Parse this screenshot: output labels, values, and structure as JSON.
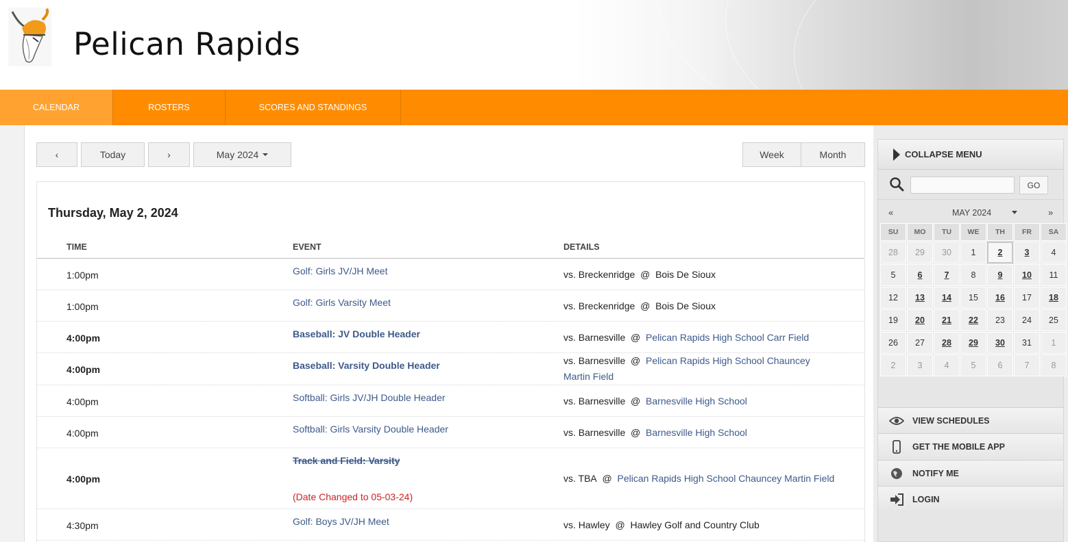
{
  "site": {
    "title": "Pelican Rapids"
  },
  "nav": [
    {
      "label": "CALENDAR"
    },
    {
      "label": "ROSTERS"
    },
    {
      "label": "SCORES AND STANDINGS"
    }
  ],
  "toolbar": {
    "prev": "‹",
    "today": "Today",
    "next": "›",
    "month_select": "May 2024",
    "week": "Week",
    "month": "Month"
  },
  "day": {
    "title": "Thursday, May 2, 2024",
    "columns": {
      "time": "TIME",
      "event": "EVENT",
      "details": "DETAILS"
    },
    "events": [
      {
        "time": "1:00pm",
        "event": "Golf: Girls JV/JH Meet",
        "opponent": "vs. Breckenridge",
        "at": "@",
        "location": "Bois De Sioux"
      },
      {
        "time": "1:00pm",
        "event": "Golf: Girls Varsity Meet",
        "opponent": "vs. Breckenridge",
        "at": "@",
        "location": "Bois De Sioux"
      },
      {
        "time": "4:00pm",
        "event": "Baseball: JV Double Header",
        "opponent": "vs. Barnesville",
        "at": "@",
        "location": "Pelican Rapids High School Carr Field"
      },
      {
        "time": "4:00pm",
        "event": "Baseball: Varsity Double Header",
        "opponent": "vs. Barnesville",
        "at": "@",
        "location": "Pelican Rapids High School Chauncey Martin Field"
      },
      {
        "time": "4:00pm",
        "event": "Softball: Girls JV/JH Double Header",
        "opponent": "vs. Barnesville",
        "at": "@",
        "location": "Barnesville High School"
      },
      {
        "time": "4:00pm",
        "event": "Softball: Girls Varsity Double Header",
        "opponent": "vs. Barnesville",
        "at": "@",
        "location": "Barnesville High School"
      },
      {
        "time": "4:00pm",
        "event": "Track and Field: Varsity",
        "note": "(Date Changed to 05-03-24)",
        "opponent": "vs. TBA",
        "at": "@",
        "location": "Pelican Rapids High School Chauncey Martin Field"
      },
      {
        "time": "4:30pm",
        "event": "Golf: Boys JV/JH Meet",
        "opponent": "vs. Hawley",
        "at": "@",
        "location": "Hawley Golf and Country Club"
      }
    ]
  },
  "sidebar": {
    "collapse": "COLLAPSE MENU",
    "search_button": "GO",
    "calendar": {
      "prev": "«",
      "next": "»",
      "month": "MAY 2024",
      "dow": [
        "SU",
        "MO",
        "TU",
        "WE",
        "TH",
        "FR",
        "SA"
      ],
      "weeks": [
        [
          "28",
          "29",
          "30",
          "1",
          "2",
          "3",
          "4"
        ],
        [
          "5",
          "6",
          "7",
          "8",
          "9",
          "10",
          "11"
        ],
        [
          "12",
          "13",
          "14",
          "15",
          "16",
          "17",
          "18"
        ],
        [
          "19",
          "20",
          "21",
          "22",
          "23",
          "24",
          "25"
        ],
        [
          "26",
          "27",
          "28",
          "29",
          "30",
          "31",
          "1"
        ],
        [
          "2",
          "3",
          "4",
          "5",
          "6",
          "7",
          "8"
        ]
      ]
    },
    "menu": [
      {
        "label": "VIEW SCHEDULES",
        "icon": "eye-icon"
      },
      {
        "label": "GET THE MOBILE APP",
        "icon": "phone-icon"
      },
      {
        "label": "NOTIFY ME",
        "icon": "globe-icon"
      },
      {
        "label": "LOGIN",
        "icon": "login-icon"
      }
    ]
  },
  "colors": {
    "accent": "#ff8c00",
    "link": "#3c5a8a",
    "alert": "#cc2222"
  }
}
